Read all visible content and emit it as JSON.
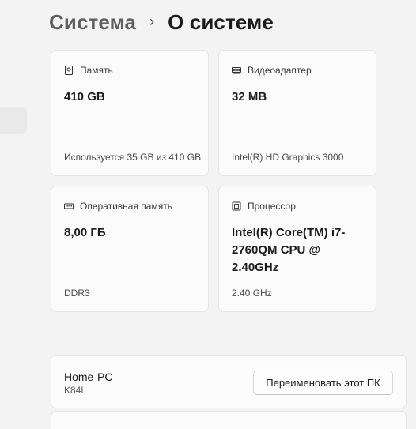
{
  "breadcrumb": {
    "parent": "Система",
    "separator": "›",
    "current": "О системе"
  },
  "cards": {
    "storage": {
      "icon": "storage-icon",
      "title": "Память",
      "value": "410 GB",
      "detail": "Используется 35 GB из 410 GB"
    },
    "gpu": {
      "icon": "display-adapter-icon",
      "title": "Видеоадаптер",
      "value": "32 MB",
      "detail": "Intel(R) HD Graphics 3000"
    },
    "ram": {
      "icon": "ram-icon",
      "title": "Оперативная память",
      "value": "8,00 ГБ",
      "detail": "DDR3"
    },
    "cpu": {
      "icon": "processor-icon",
      "title": "Процессор",
      "value": "Intel(R) Core(TM) i7-2760QM CPU @ 2.40GHz",
      "detail": "2.40 GHz"
    }
  },
  "device": {
    "name": "Home-PC",
    "model": "K84L",
    "rename_label": "Переименовать этот ПК"
  }
}
